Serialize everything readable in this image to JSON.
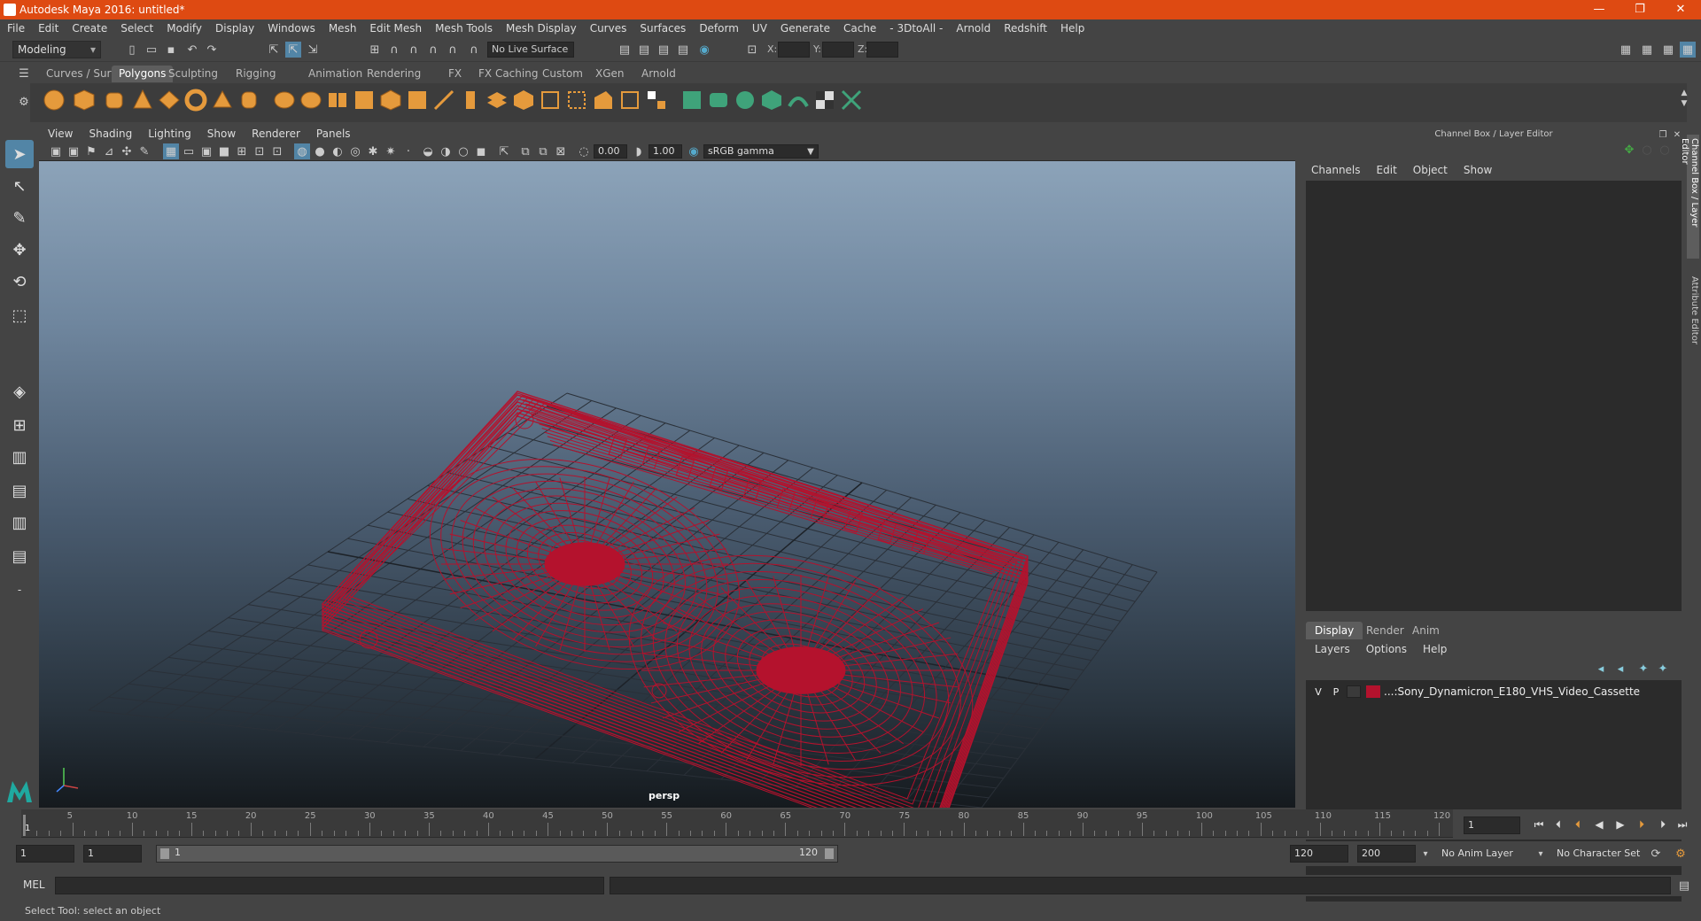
{
  "window": {
    "title": "Autodesk Maya 2016: untitled*",
    "minimize": "—",
    "restore": "❐",
    "close": "✕"
  },
  "menubar": [
    "File",
    "Edit",
    "Create",
    "Select",
    "Modify",
    "Display",
    "Windows",
    "Mesh",
    "Edit Mesh",
    "Mesh Tools",
    "Mesh Display",
    "Curves",
    "Surfaces",
    "Deform",
    "UV",
    "Generate",
    "Cache",
    "- 3DtoAll -",
    "Arnold",
    "Redshift",
    "Help"
  ],
  "statusline": {
    "mode": "Modeling",
    "live_surface": "No Live Surface",
    "x_label": "X:",
    "y_label": "Y:",
    "z_label": "Z:"
  },
  "shelf": {
    "tabs": [
      "Curves / Surfaces",
      "Polygons",
      "Sculpting",
      "Rigging",
      "Animation",
      "Rendering",
      "FX",
      "FX Caching",
      "Custom",
      "XGen",
      "Arnold"
    ],
    "active_tab": "Polygons"
  },
  "panel": {
    "menus": [
      "View",
      "Shading",
      "Lighting",
      "Show",
      "Renderer",
      "Panels"
    ],
    "exposure": "0.00",
    "gamma": "1.00",
    "color_space": "sRGB gamma",
    "camera_label": "persp"
  },
  "colors": {
    "wire": "#b4122d",
    "title_bar": "#de4a12"
  },
  "channel_box": {
    "header": "Channel Box / Layer Editor",
    "menus": [
      "Channels",
      "Edit",
      "Object",
      "Show"
    ]
  },
  "layer_editor": {
    "tabs": [
      "Display",
      "Render",
      "Anim"
    ],
    "active_tab": "Display",
    "menus": [
      "Layers",
      "Options",
      "Help"
    ],
    "layers": [
      {
        "v": "V",
        "p": "P",
        "name": "...:Sony_Dynamicron_E180_VHS_Video_Cassette"
      }
    ]
  },
  "side_tabs": [
    "Channel Box / Layer Editor",
    "Attribute Editor"
  ],
  "timeline": {
    "ticks": [
      "5",
      "10",
      "15",
      "20",
      "25",
      "30",
      "35",
      "40",
      "45",
      "50",
      "55",
      "60",
      "65",
      "70",
      "75",
      "80",
      "85",
      "90",
      "95",
      "100",
      "105",
      "110",
      "115",
      "120"
    ],
    "start_tick": "1",
    "current_frame": "1"
  },
  "range": {
    "start": "1",
    "playback_start": "1",
    "slider_start": "1",
    "slider_end": "120",
    "playback_end": "120",
    "end": "200",
    "anim_layer": "No Anim Layer",
    "character_set": "No Character Set"
  },
  "command": {
    "label": "MEL"
  },
  "help_line": "Select Tool: select an object"
}
